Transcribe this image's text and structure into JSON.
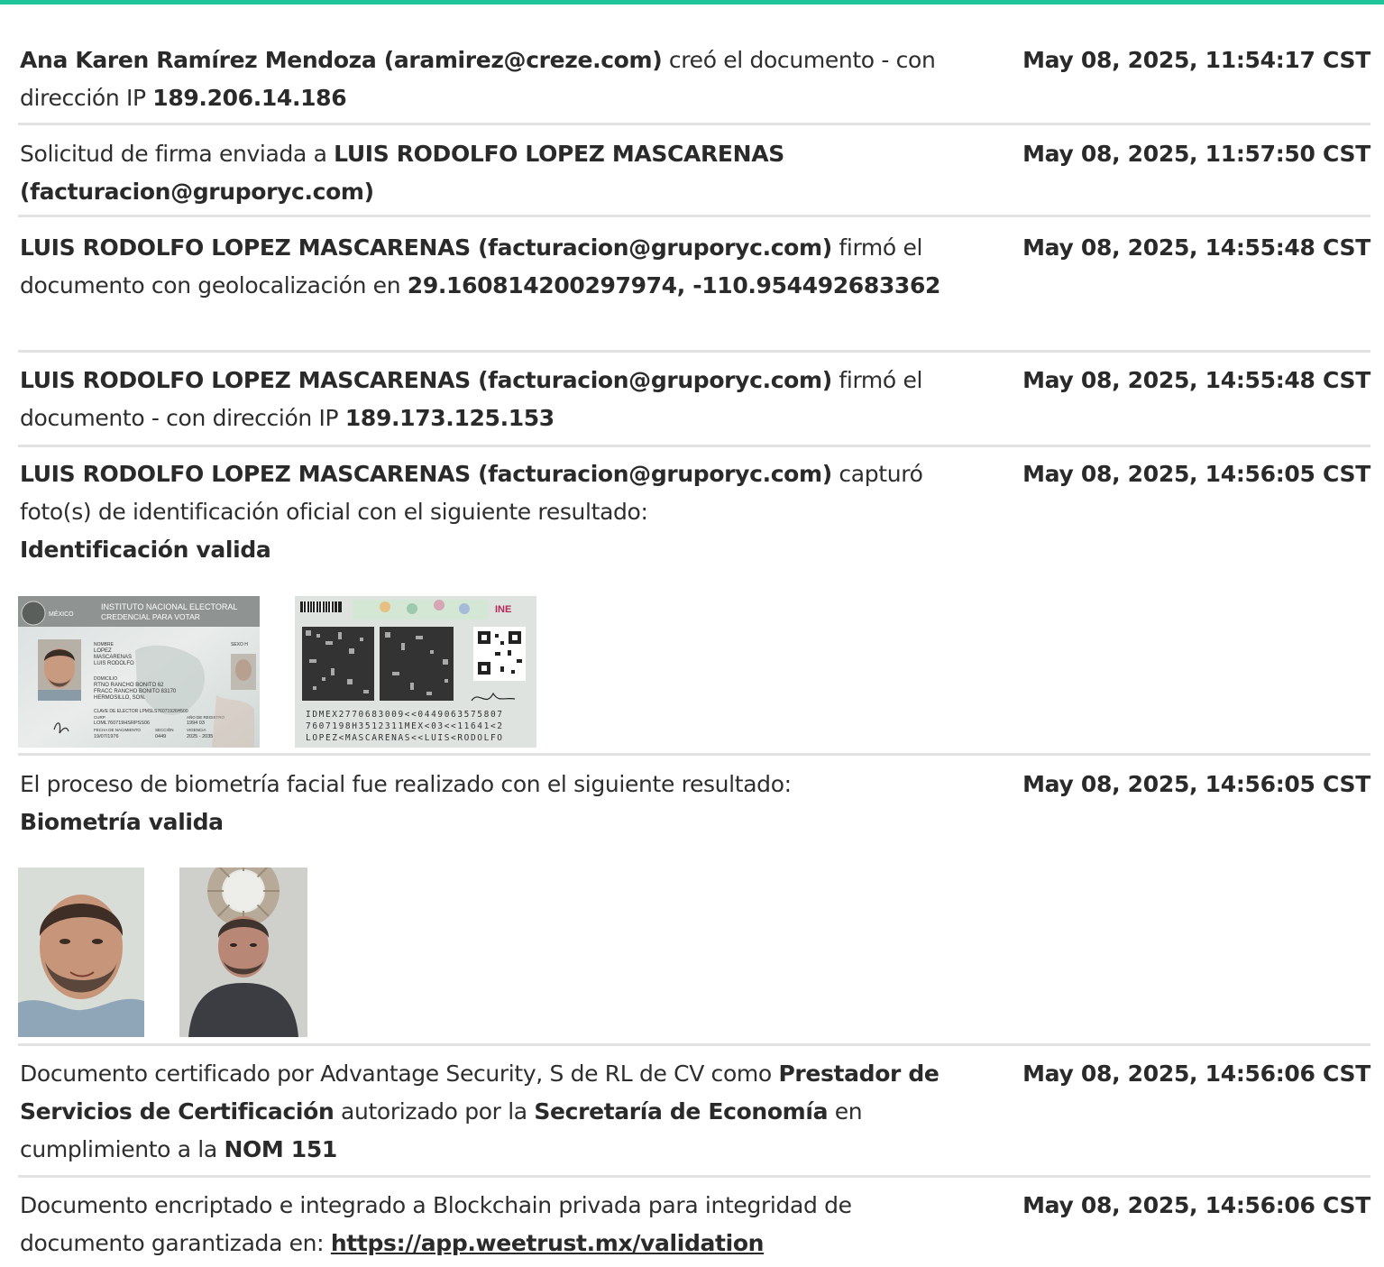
{
  "entries": [
    {
      "actor": "Ana Karen Ramírez Mendoza (aramirez@creze.com)",
      "text1": " creó el documento - con dirección IP ",
      "ip": "189.206.14.186",
      "time": "May 08, 2025, 11:54:17 CST"
    },
    {
      "text1": "Solicitud de firma enviada a ",
      "recipient": "LUIS RODOLFO LOPEZ MASCARENAS (facturacion@gruporyc.com)",
      "time": "May 08, 2025, 11:57:50 CST"
    },
    {
      "actor": "LUIS RODOLFO LOPEZ MASCARENAS (facturacion@gruporyc.com)",
      "text1": " firmó el documento con geolocalización en ",
      "geo": "29.160814200297974, -110.954492683362",
      "time": "May 08, 2025, 14:55:48 CST"
    },
    {
      "actor": "LUIS RODOLFO LOPEZ MASCARENAS (facturacion@gruporyc.com)",
      "text1": " firmó el documento - con dirección IP ",
      "ip": "189.173.125.153",
      "time": "May 08, 2025, 14:55:48 CST"
    },
    {
      "actor": "LUIS RODOLFO LOPEZ MASCARENAS (facturacion@gruporyc.com)",
      "text1": " capturó foto(s) de identificación oficial con el siguiente resultado:",
      "result": "Identificación valida",
      "time": "May 08, 2025, 14:56:05 CST"
    },
    {
      "text1": "El proceso de biometría facial fue realizado con el siguiente resultado:",
      "result": "Biometría valida",
      "time": "May 08, 2025, 14:56:05 CST"
    },
    {
      "text1": "Documento certificado por Advantage Security, S de RL de CV como ",
      "bold1": "Prestador de Servicios de Certificación",
      "text2": " autorizado por la ",
      "bold2": "Secretaría de Economía",
      "text3": " en cumplimiento a la ",
      "bold3": "NOM 151",
      "time": "May 08, 2025, 14:56:06 CST"
    },
    {
      "text1": "Documento encriptado e integrado a Blockchain privada para integridad de documento garantizada en: ",
      "link": "https://app.weetrust.mx/validation",
      "time": "May 08, 2025, 14:56:06 CST"
    }
  ],
  "id_front": {
    "country": "MÉXICO",
    "institute": "INSTITUTO NACIONAL ELECTORAL",
    "card": "CREDENCIAL PARA VOTAR",
    "sexo": "SEXO H",
    "nombre_label": "NOMBRE",
    "nombre": [
      "LOPEZ",
      "MASCARENAS",
      "LUIS RODOLFO"
    ],
    "domicilio_label": "DOMICILIO",
    "domicilio": [
      "RTNO RANCHO BONITO 62",
      "FRACC RANCHO BONITO 83170",
      "HERMOSILLO, SON."
    ],
    "clave": "CLAVE DE ELECTOR  LPMSLS76071926H500",
    "curp_label": "CURP",
    "curp": "LOML760719HSRPSS06",
    "anio_label": "AÑO DE REGISTRO",
    "anio": "1994 03",
    "nac_label": "FECHA DE NACIMIENTO",
    "nac": "19/07/1976",
    "seccion_label": "SECCIÓN",
    "seccion": "0449",
    "vigencia_label": "VIGENCIA",
    "vigencia": "2025 - 2035"
  },
  "id_back": {
    "brand": "INE",
    "mrz": [
      "IDMEX2770683009<<0449063575807",
      "7607198H3512311MEX<03<<11641<2",
      "LOPEZ<MASCARENAS<<LUIS<RODOLFO"
    ]
  },
  "colors": {
    "accent": "#1fc59a",
    "divider": "#e2e2e2",
    "text": "#2e2e2e"
  }
}
